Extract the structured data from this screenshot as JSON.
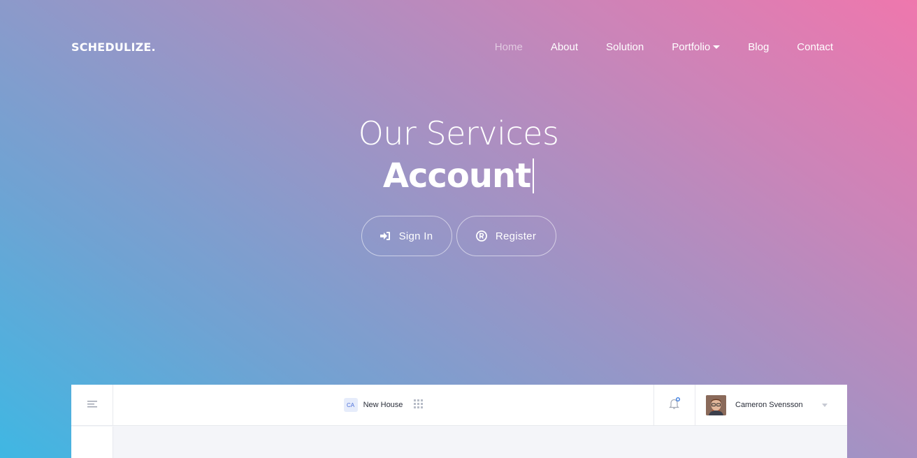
{
  "brand": "SCHEDULIZE.",
  "nav": {
    "items": [
      {
        "label": "Home"
      },
      {
        "label": "About"
      },
      {
        "label": "Solution"
      },
      {
        "label": "Portfolio"
      },
      {
        "label": "Blog"
      },
      {
        "label": "Contact"
      }
    ]
  },
  "hero": {
    "subtitle": "Our Services",
    "typed_word": "Account"
  },
  "buttons": {
    "signin": "Sign In",
    "register": "Register"
  },
  "app_preview": {
    "project_badge": "CA",
    "project_name": "New House",
    "user_name": "Cameron Svensson"
  },
  "colors": {
    "gradient_start": "#3fb7e3",
    "gradient_end": "#ef77ad"
  }
}
